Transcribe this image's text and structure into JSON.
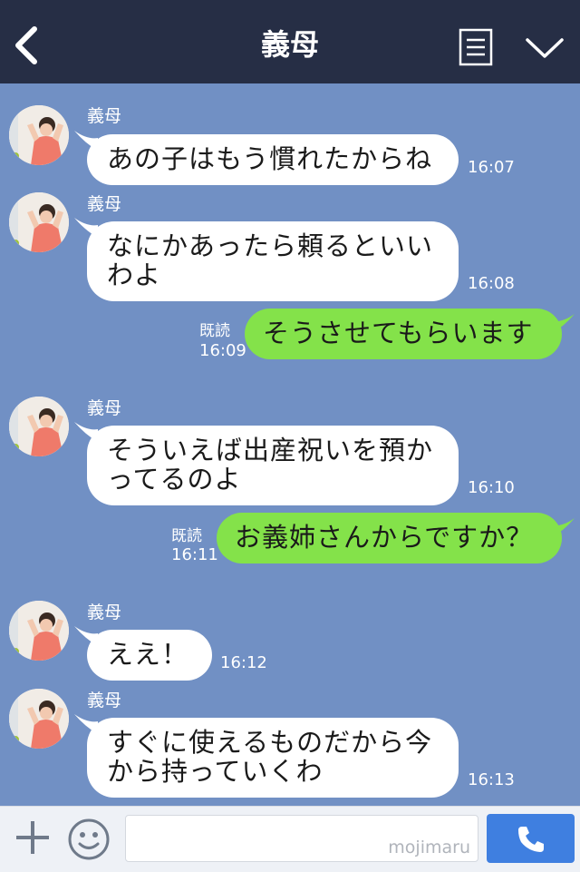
{
  "header": {
    "title": "義母",
    "back_icon": "chevron-left-icon",
    "menu_icon": "list-icon",
    "collapse_icon": "chevron-down-icon",
    "background": "#262e45"
  },
  "chat": {
    "background": "#7190c4",
    "messages": [
      {
        "direction": "in",
        "sender": "義母",
        "text": "あの子はもう慣れたからね",
        "time": "16:07"
      },
      {
        "direction": "in",
        "sender": "義母",
        "text": "なにかあったら頼るといい\nわよ",
        "time": "16:08"
      },
      {
        "direction": "out",
        "text": "そうさせてもらいます",
        "read": "既読",
        "time": "16:09"
      },
      {
        "direction": "in",
        "sender": "義母",
        "text": "そういえば出産祝いを預か\nってるのよ",
        "time": "16:10"
      },
      {
        "direction": "out",
        "text": "お義姉さんからですか？",
        "read": "既読",
        "time": "16:11"
      },
      {
        "direction": "in",
        "sender": "義母",
        "text": "ええ！",
        "time": "16:12"
      },
      {
        "direction": "in",
        "sender": "義母",
        "text": "すぐに使えるものだから今\nから持っていくわ",
        "time": "16:13"
      }
    ]
  },
  "footer": {
    "plus_icon": "plus-icon",
    "emoji_icon": "smiley-icon",
    "input_value": "",
    "watermark": "mojimaru",
    "send_icon": "phone-icon",
    "send_color": "#3f7fe0"
  },
  "colors": {
    "incoming_bubble": "#ffffff",
    "outgoing_bubble": "#84e24a"
  }
}
